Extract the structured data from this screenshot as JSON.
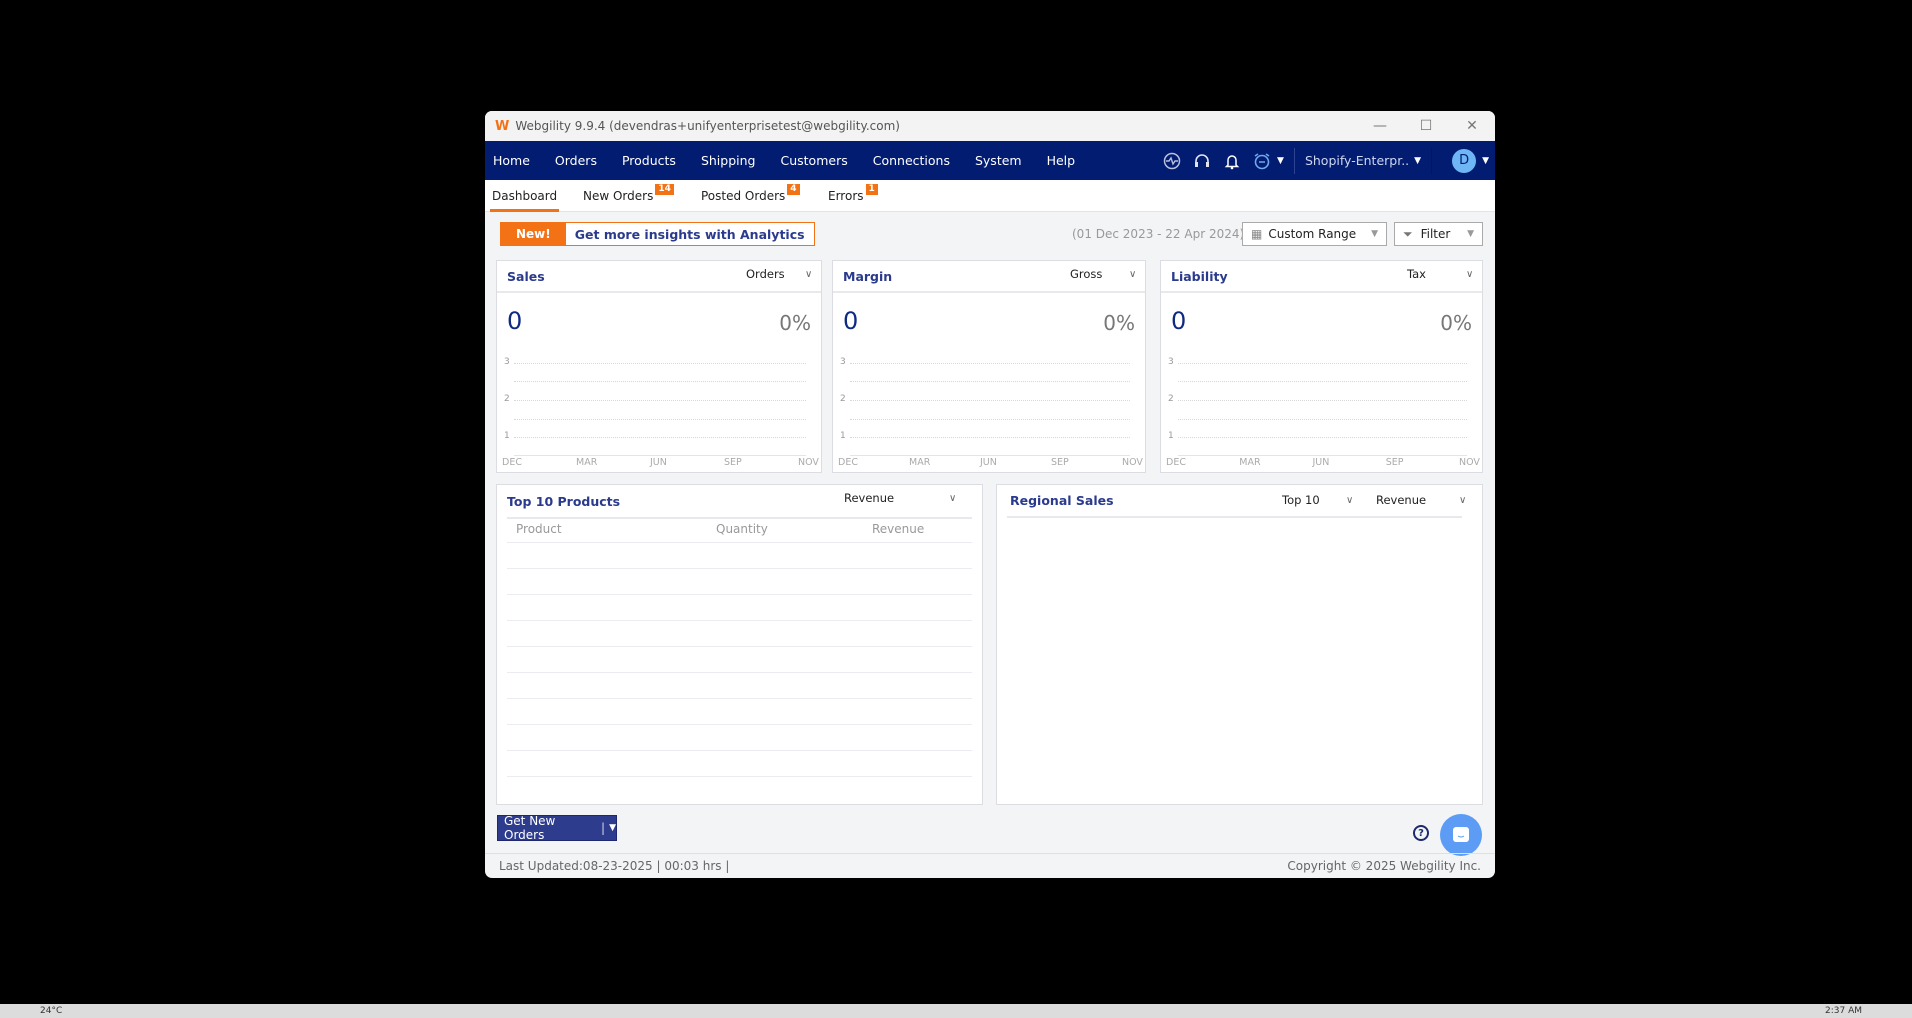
{
  "window": {
    "title": "Webgility 9.9.4 (devendras+unifyenterprisetest@webgility.com)",
    "minimize": "—",
    "maximize": "☐",
    "close": "✕"
  },
  "nav": {
    "items": [
      "Home",
      "Orders",
      "Products",
      "Shipping",
      "Customers",
      "Connections",
      "System",
      "Help"
    ],
    "store": "Shopify-Enterpr..",
    "avatar": "D"
  },
  "tabs": [
    {
      "label": "Dashboard"
    },
    {
      "label": "New Orders",
      "badge": "14"
    },
    {
      "label": "Posted Orders",
      "badge": "4"
    },
    {
      "label": "Errors",
      "badge": "1"
    }
  ],
  "banner": {
    "new": "New!",
    "cta": "Get more insights with Analytics"
  },
  "toolbar": {
    "date_range": "(01 Dec 2023 - 22 Apr 2024)",
    "range": "Custom Range",
    "filter": "Filter"
  },
  "cards": [
    {
      "title": "Sales",
      "select": "Orders",
      "value": "0",
      "change": "0%"
    },
    {
      "title": "Margin",
      "select": "Gross",
      "value": "0",
      "change": "0%"
    },
    {
      "title": "Liability",
      "select": "Tax",
      "value": "0",
      "change": "0%"
    }
  ],
  "chart_axis": {
    "y_ticks": [
      "3",
      "2",
      "1"
    ],
    "x_ticks": [
      "DEC",
      "MAR",
      "JUN",
      "SEP",
      "NOV"
    ]
  },
  "top_products": {
    "title": "Top 10 Products",
    "select": "Revenue",
    "columns": [
      "Product",
      "Quantity",
      "Revenue"
    ]
  },
  "regional": {
    "title": "Regional Sales",
    "select_top": "Top 10",
    "select_metric": "Revenue"
  },
  "actions": {
    "get_new_orders": "Get New Orders"
  },
  "footer": {
    "last_updated": "Last Updated:08-23-2025 | 00:03 hrs |",
    "copyright": "Copyright © 2025 Webgility Inc."
  },
  "taskbar": {
    "weather": "24°C",
    "clock": "2:37 AM"
  }
}
